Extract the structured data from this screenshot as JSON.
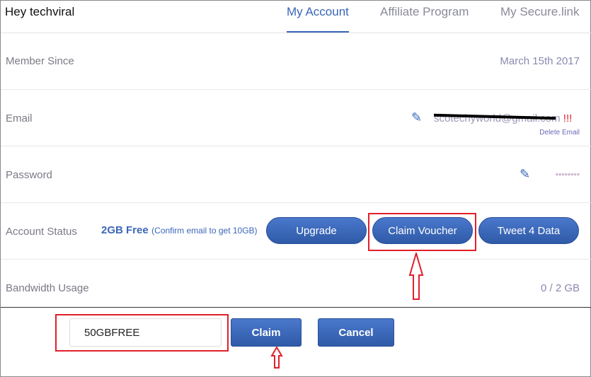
{
  "header": {
    "greeting": "Hey techviral",
    "tabs": [
      {
        "label": "My Account",
        "active": true
      },
      {
        "label": "Affiliate Program"
      },
      {
        "label": "My Secure.link"
      }
    ]
  },
  "rows": {
    "member_since": {
      "label": "Member Since",
      "value": "March 15th 2017"
    },
    "email": {
      "label": "Email",
      "value": "scotechyworld@gmail.com",
      "warning": "!!!",
      "delete": "Delete Email"
    },
    "password": {
      "label": "Password",
      "value": "********"
    },
    "status": {
      "label": "Account Status",
      "plan": "2GB Free",
      "note": "(Confirm email to get 10GB)",
      "upgrade": "Upgrade",
      "claim_voucher": "Claim Voucher",
      "tweet": "Tweet 4 Data"
    },
    "bandwidth": {
      "label": "Bandwidth Usage",
      "value": "0 / 2 GB"
    }
  },
  "voucher": {
    "code": "50GBFREE",
    "claim": "Claim",
    "cancel": "Cancel"
  },
  "colors": {
    "accent": "#3b66b8",
    "annotation": "#e0202a"
  }
}
